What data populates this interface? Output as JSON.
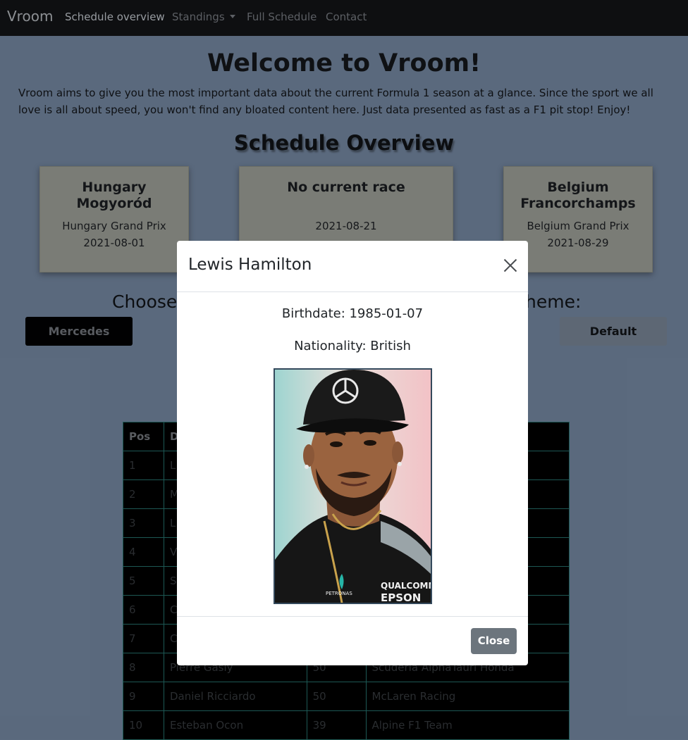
{
  "navbar": {
    "brand": "Vroom",
    "links": [
      "Schedule overview",
      "Standings",
      "Full Schedule",
      "Contact"
    ]
  },
  "welcome": "Welcome to Vroom!",
  "intro": "Vroom aims to give you the most important data about the current Formula 1 season at a glance. Since the sport we all love is all about speed, you won't find any bloated content here. Just data presented as fast as a F1 pit stop! Enjoy!",
  "schedule_title": "Schedule Overview",
  "cards": [
    {
      "location_line1": "Hungary",
      "location_line2": "Mogyoród",
      "name": "Hungary Grand Prix",
      "date": "2021-08-01"
    },
    {
      "location_line1": "No current race",
      "location_line2": "",
      "name": "",
      "date": "2021-08-21"
    },
    {
      "location_line1": "Belgium",
      "location_line2": "Francorchamps",
      "name": "Belgium Grand Prix",
      "date": "2021-08-29"
    }
  ],
  "theme": {
    "choose_left": "Choose",
    "choose_right": "heme:",
    "mercedes_button": "Mercedes",
    "default_button": "Default"
  },
  "table": {
    "headers": [
      "Pos",
      "D",
      "",
      ""
    ],
    "rows": [
      [
        "1",
        "L",
        "",
        ""
      ],
      [
        "2",
        "M",
        "",
        ""
      ],
      [
        "3",
        "L",
        "",
        ""
      ],
      [
        "4",
        "V",
        "",
        ""
      ],
      [
        "5",
        "S",
        "",
        ""
      ],
      [
        "6",
        "C",
        "",
        ""
      ],
      [
        "7",
        "C",
        "",
        ""
      ],
      [
        "8",
        "Pierre Gasly",
        "50",
        "Scuderia AlphaTauri Honda"
      ],
      [
        "9",
        "Daniel Ricciardo",
        "50",
        "McLaren Racing"
      ],
      [
        "10",
        "Esteban Ocon",
        "39",
        "Alpine F1 Team"
      ]
    ]
  },
  "modal": {
    "title": "Lewis Hamilton",
    "birthdate": "Birthdate: 1985-01-07",
    "nationality": "Nationality: British",
    "close_button": "Close",
    "photo_text_1": "QUALCOMM",
    "photo_text_2": "EPSON",
    "photo_text_3": "PETRONAS"
  },
  "colors": {
    "page_background": "#5c6b7f",
    "navbar_background": "#0f1012",
    "close_button": "#6c757d"
  }
}
